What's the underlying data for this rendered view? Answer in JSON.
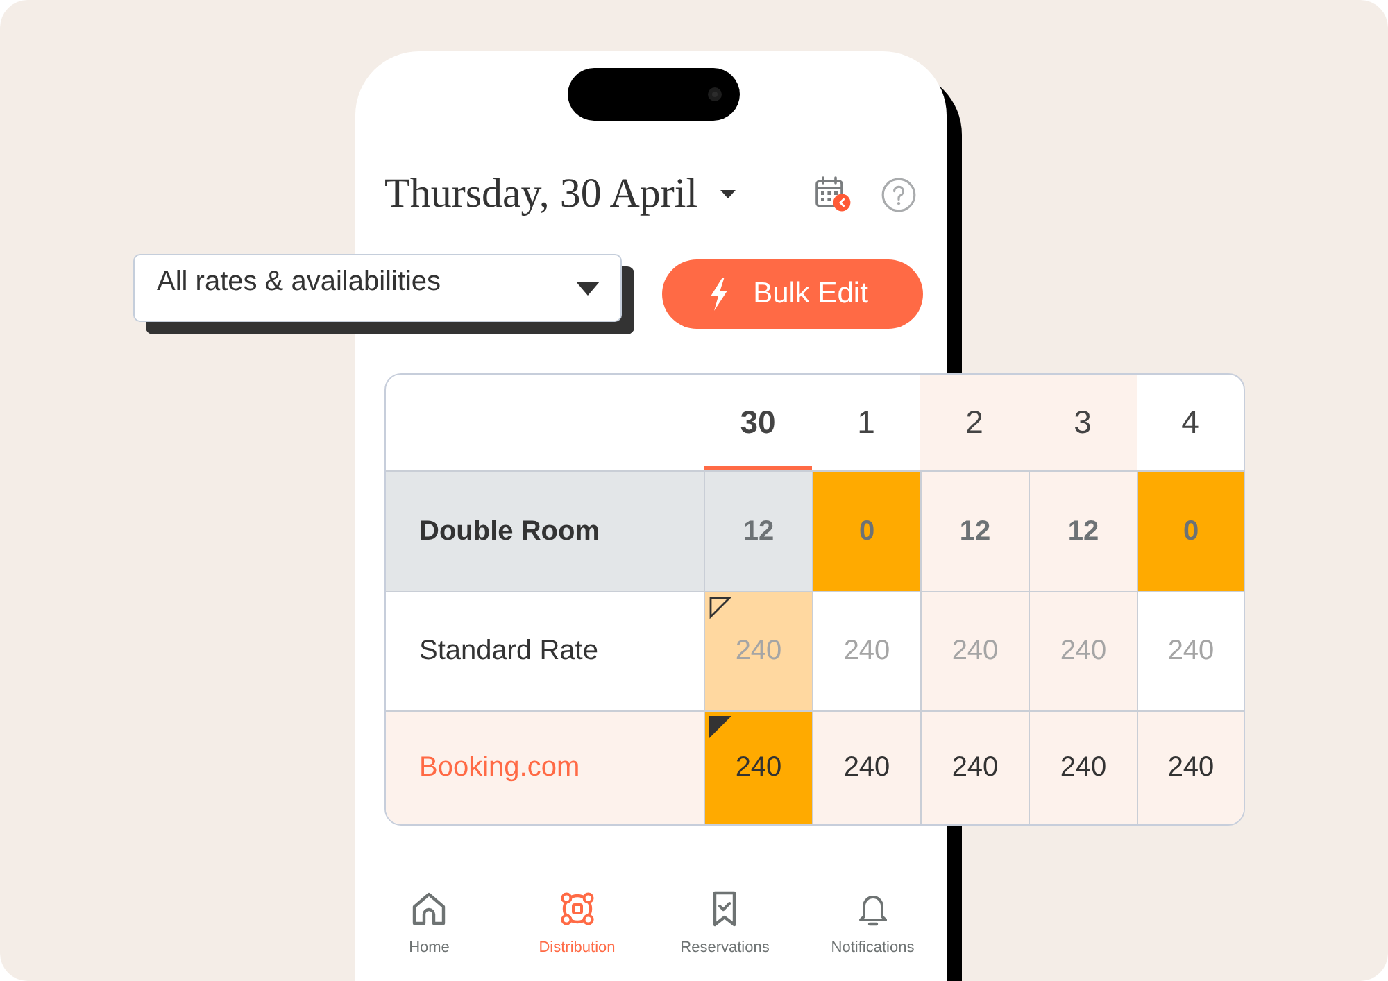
{
  "header": {
    "title": "Thursday, 30 April"
  },
  "filter": {
    "value": "All rates & availabilities"
  },
  "bulk_edit_button": {
    "label": "Bulk Edit"
  },
  "table": {
    "columns": [
      {
        "label": "30",
        "selected": true,
        "highlighted": false
      },
      {
        "label": "1",
        "selected": false,
        "highlighted": false
      },
      {
        "label": "2",
        "selected": false,
        "highlighted": true
      },
      {
        "label": "3",
        "selected": false,
        "highlighted": true
      },
      {
        "label": "4",
        "selected": false,
        "highlighted": false
      }
    ],
    "rows": [
      {
        "label": "Double Room",
        "kind": "room",
        "cells": [
          {
            "value": "12"
          },
          {
            "value": "0",
            "color": "#ffaa00"
          },
          {
            "value": "12"
          },
          {
            "value": "12"
          },
          {
            "value": "0",
            "color": "#ffaa00"
          }
        ]
      },
      {
        "label": "Standard Rate",
        "kind": "rate",
        "cells": [
          {
            "value": "240",
            "color": "#ffd8a0",
            "marker": {
              "kind": "outline"
            }
          },
          {
            "value": "240"
          },
          {
            "value": "240"
          },
          {
            "value": "240"
          },
          {
            "value": "240"
          }
        ]
      },
      {
        "label": "Booking.com",
        "kind": "channel",
        "cells": [
          {
            "value": "240",
            "color": "#ffaa00",
            "marker": {
              "kind": "filled"
            }
          },
          {
            "value": "240"
          },
          {
            "value": "240"
          },
          {
            "value": "240"
          },
          {
            "value": "240"
          }
        ]
      }
    ]
  },
  "bottom_nav": {
    "tabs": [
      {
        "label": "Home",
        "selected": false
      },
      {
        "label": "Distribution",
        "selected": true
      },
      {
        "label": "Reservations",
        "selected": false
      },
      {
        "label": "Notifications",
        "selected": false
      }
    ]
  }
}
